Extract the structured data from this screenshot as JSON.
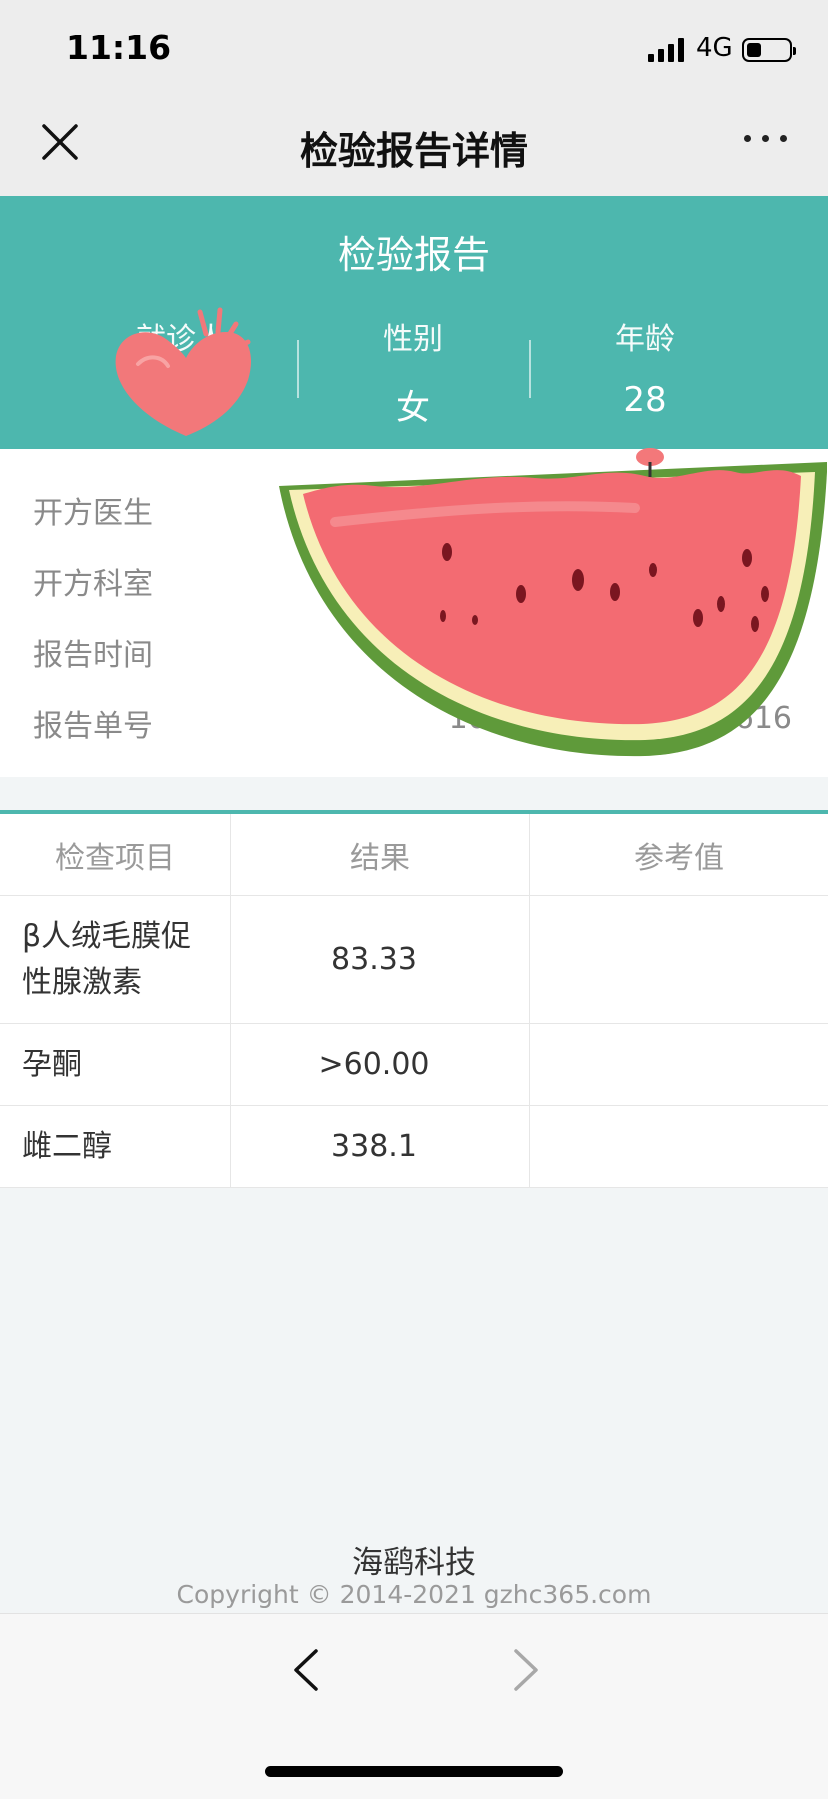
{
  "status_bar": {
    "time": "11:16",
    "network": "4G",
    "battery_level": 0.35
  },
  "nav": {
    "title": "检验报告详情"
  },
  "report": {
    "title": "检验报告",
    "patient_label": "就诊人",
    "gender_label": "性别",
    "gender_value": "女",
    "age_label": "年龄",
    "age_value": "28"
  },
  "info": [
    {
      "label": "开方医生",
      "value": ""
    },
    {
      "label": "开方科室",
      "value": ""
    },
    {
      "label": "报告时间",
      "value": "1"
    },
    {
      "label": "报告单号",
      "value": "100                    24616"
    }
  ],
  "table": {
    "headers": [
      "检查项目",
      "结果",
      "参考值"
    ],
    "rows": [
      {
        "item": "β人绒毛膜促性腺激素",
        "result": "83.33",
        "reference": ""
      },
      {
        "item": "孕酮",
        "result": ">60.00",
        "reference": ""
      },
      {
        "item": "雌二醇",
        "result": "338.1",
        "reference": ""
      }
    ]
  },
  "footer": {
    "brand": "海鹞科技",
    "copyright": "Copyright © 2014-2021 gzhc365.com"
  },
  "colors": {
    "accent": "#4db7ae",
    "background": "#f2f5f6"
  },
  "icons": [
    "close-icon",
    "more-icon",
    "back-icon",
    "forward-icon",
    "heart-sticker",
    "watermelon-sticker"
  ]
}
